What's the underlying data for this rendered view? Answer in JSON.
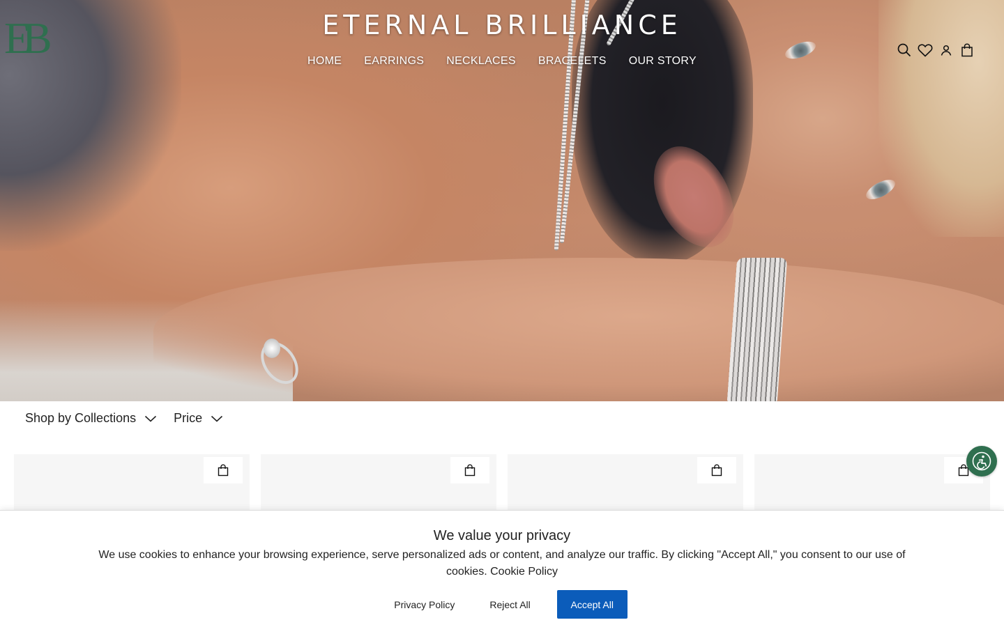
{
  "header": {
    "brand": "ETERNAL BRILLIANCE",
    "logo_letters": "EB",
    "nav": [
      {
        "label": "HOME"
      },
      {
        "label": "EARRINGS"
      },
      {
        "label": "NECKLACES"
      },
      {
        "label": "BRACELETS"
      },
      {
        "label": "OUR STORY"
      }
    ],
    "icons": [
      "search-icon",
      "heart-icon",
      "account-icon",
      "bag-icon"
    ]
  },
  "filters": [
    {
      "label": "Shop by Collections"
    },
    {
      "label": "Price"
    }
  ],
  "products": [
    {
      "cart_icon": "bag-icon"
    },
    {
      "cart_icon": "bag-icon"
    },
    {
      "cart_icon": "bag-icon"
    },
    {
      "cart_icon": "bag-icon"
    }
  ],
  "cookie_banner": {
    "title": "We value your privacy",
    "message": "We use cookies to enhance your browsing experience, serve personalized ads or content, and analyze our traffic. By clicking \"Accept All,\" you consent to our use of cookies.",
    "policy_link": "Cookie Policy",
    "privacy_link": "Privacy Policy",
    "reject_label": "Reject All",
    "accept_label": "Accept All"
  },
  "colors": {
    "accent": "#0b5cba",
    "brand_green": "#2f6f4f"
  },
  "accessibility": {
    "icon": "accessibility-icon"
  }
}
